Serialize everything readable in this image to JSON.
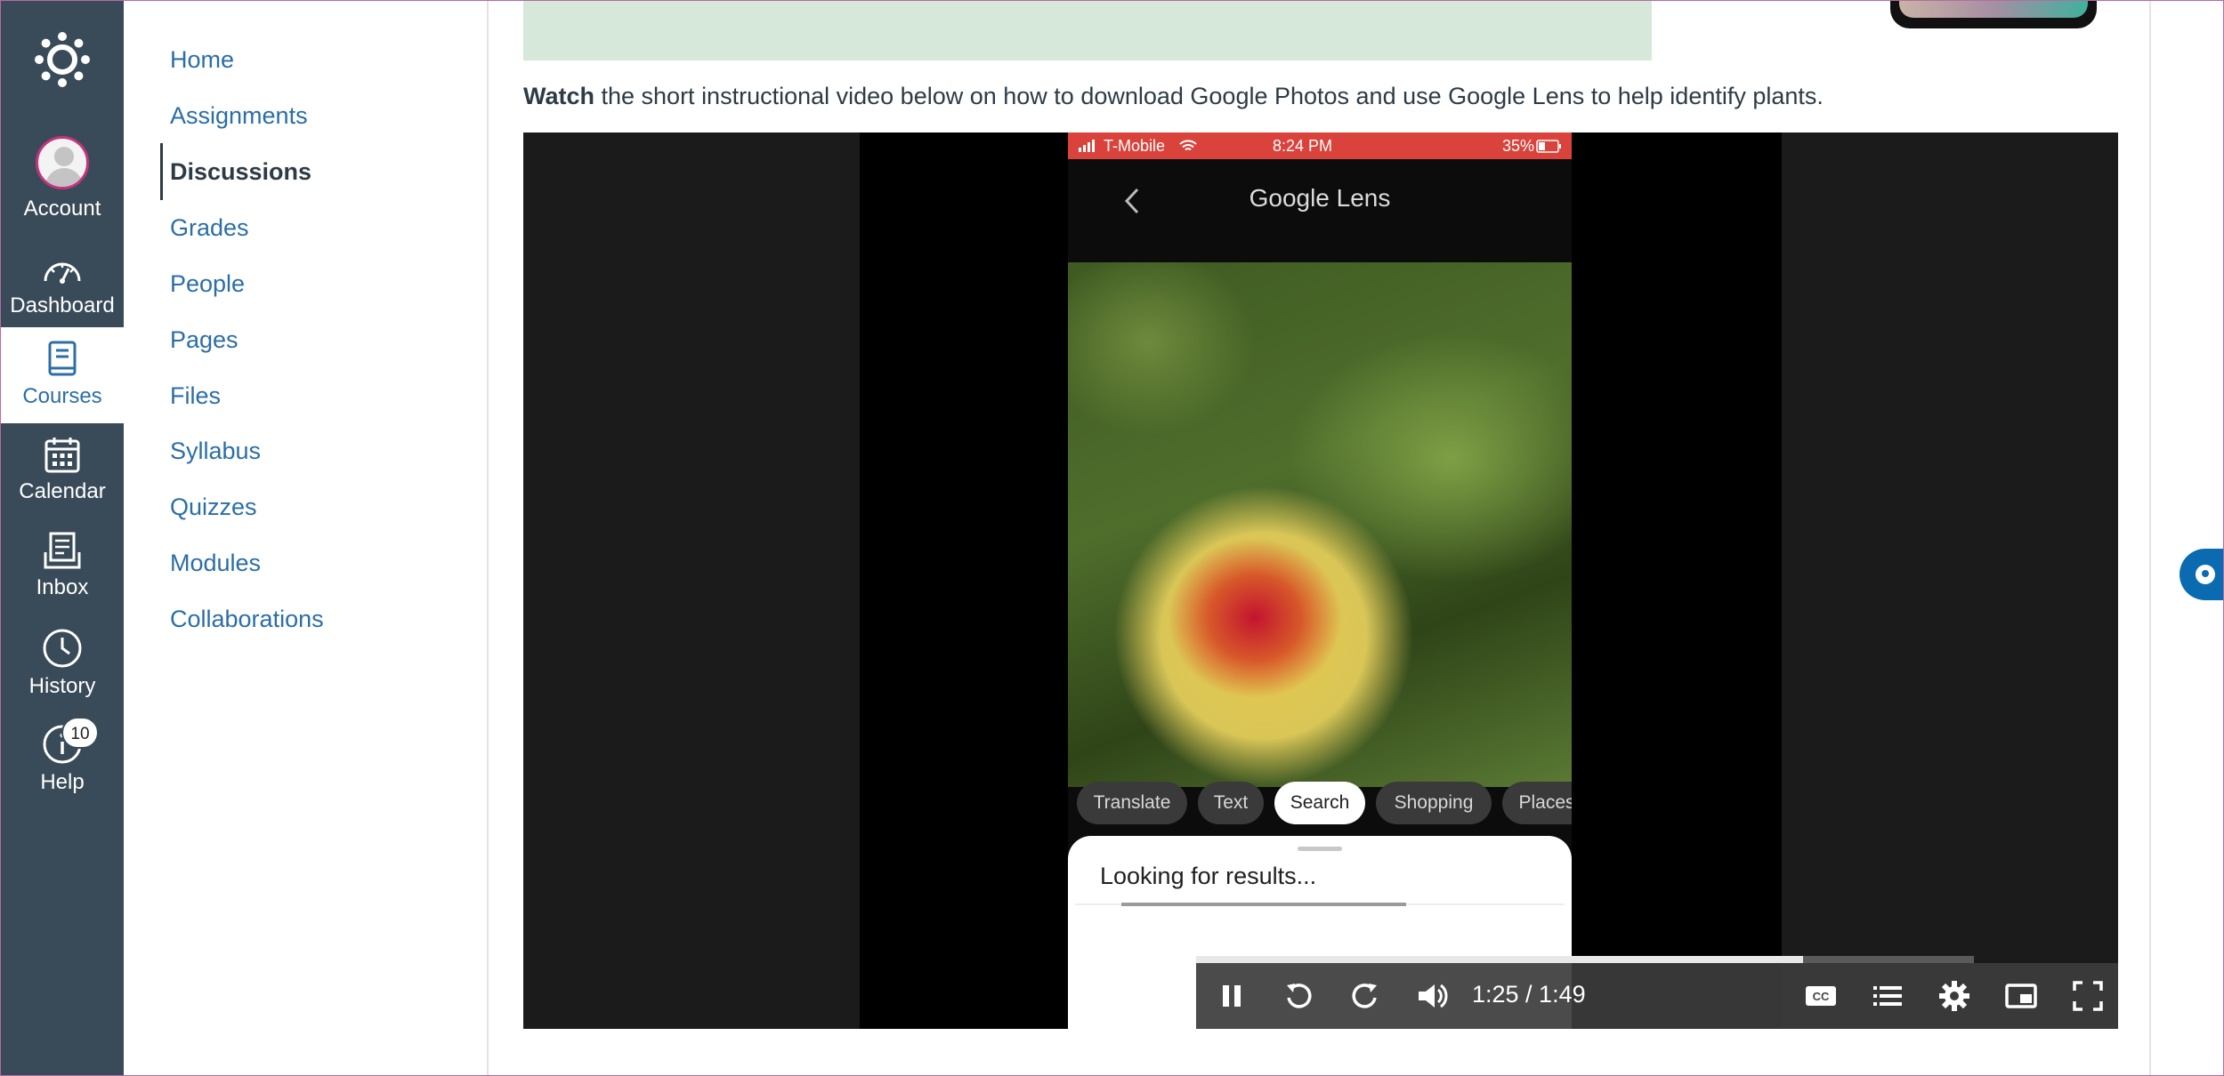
{
  "global_nav": {
    "items": [
      {
        "label": "Account"
      },
      {
        "label": "Dashboard"
      },
      {
        "label": "Courses"
      },
      {
        "label": "Calendar"
      },
      {
        "label": "Inbox"
      },
      {
        "label": "History"
      },
      {
        "label": "Help",
        "badge": "10"
      }
    ]
  },
  "course_nav": {
    "items": [
      {
        "label": "Home"
      },
      {
        "label": "Assignments"
      },
      {
        "label": "Discussions"
      },
      {
        "label": "Grades"
      },
      {
        "label": "People"
      },
      {
        "label": "Pages"
      },
      {
        "label": "Files"
      },
      {
        "label": "Syllabus"
      },
      {
        "label": "Quizzes"
      },
      {
        "label": "Modules"
      },
      {
        "label": "Collaborations"
      }
    ],
    "current": "Discussions"
  },
  "content": {
    "intro_bold": "Watch",
    "intro_rest": " the short instructional video below on how to download Google Photos and use Google Lens to help identify plants."
  },
  "video": {
    "status_bar": {
      "carrier": "T-Mobile",
      "time": "8:24 PM",
      "battery": "35%"
    },
    "lens_title": "Google Lens",
    "chips": [
      {
        "label": "Translate"
      },
      {
        "label": "Text"
      },
      {
        "label": "Search"
      },
      {
        "label": "Shopping"
      },
      {
        "label": "Places"
      }
    ],
    "selected_chip": "Search",
    "sheet_text": "Looking for results...",
    "time_display": "1:25 / 1:49",
    "played_fraction": 0.78
  },
  "colors": {
    "nav_bg": "#394b58",
    "link": "#2b6ea6",
    "status_bar": "#d9433c"
  }
}
